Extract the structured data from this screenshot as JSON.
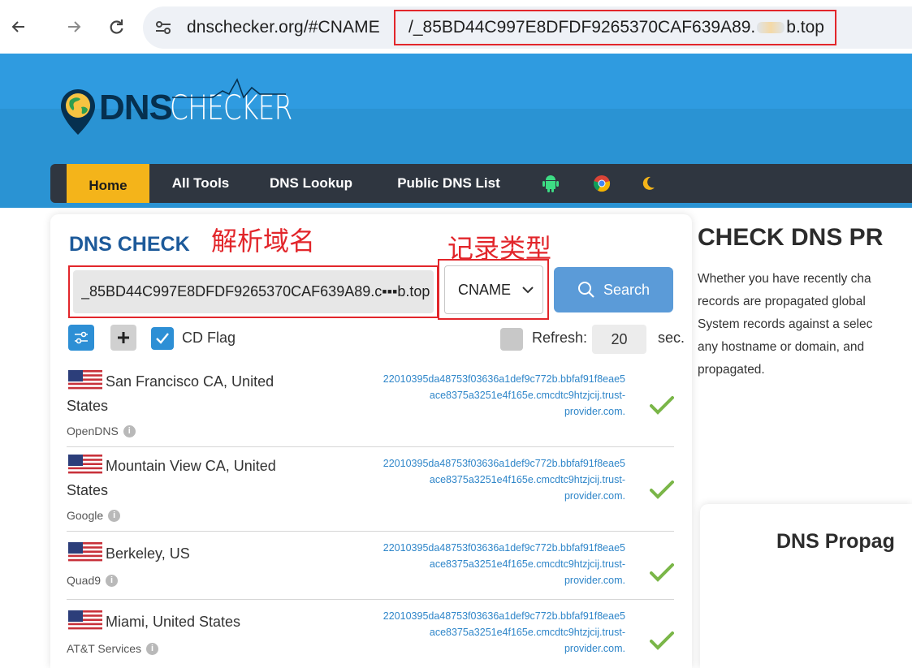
{
  "browser": {
    "url_prefix": "dnschecker.org/#CNAME",
    "url_highlight_start": "/_85BD44C997E8DFDF9265370CAF639A89.",
    "url_highlight_end": "b.top"
  },
  "logo": {
    "part1": "DNS",
    "part2": "CHECKER"
  },
  "nav": {
    "home": "Home",
    "all_tools": "All Tools",
    "dns_lookup": "DNS Lookup",
    "public_dns_list": "Public DNS List"
  },
  "dns_check": {
    "title": "DNS CHECK",
    "annotation_domain": "解析域名",
    "annotation_type": "记录类型",
    "domain_value": "_85BD44C997E8DFDF9265370CAF639A89.c▪▪▪b.top",
    "record_type": "CNAME",
    "search_label": "Search",
    "cd_flag_label": "CD Flag",
    "refresh_label": "Refresh:",
    "refresh_value": "20",
    "sec_label": "sec."
  },
  "results": [
    {
      "location": "San Francisco CA, United States",
      "provider": "OpenDNS",
      "cname": [
        "22010395da48753f03636a1def9c772b.bbfaf91f8eae5",
        "ace8375a3251e4f165e.cmcdtc9htzjcij.trust-",
        "provider.com."
      ]
    },
    {
      "location": "Mountain View CA, United States",
      "provider": "Google",
      "cname": [
        "22010395da48753f03636a1def9c772b.bbfaf91f8eae5",
        "ace8375a3251e4f165e.cmcdtc9htzjcij.trust-",
        "provider.com."
      ]
    },
    {
      "location": "Berkeley, US",
      "provider": "Quad9",
      "cname": [
        "22010395da48753f03636a1def9c772b.bbfaf91f8eae5",
        "ace8375a3251e4f165e.cmcdtc9htzjcij.trust-",
        "provider.com."
      ]
    },
    {
      "location": "Miami, United States",
      "provider": "AT&T Services",
      "cname": [
        "22010395da48753f03636a1def9c772b.bbfaf91f8eae5",
        "ace8375a3251e4f165e.cmcdtc9htzjcij.trust-",
        "provider.com."
      ]
    }
  ],
  "right": {
    "title": "CHECK DNS PR",
    "desc_lines": [
      "Whether you have recently cha",
      "records are propagated global",
      "System records against a selec",
      "any hostname or domain, and",
      "propagated."
    ],
    "prop_title": "DNS Propag"
  },
  "colors": {
    "header_blue": "#2a93d3",
    "nav_dark": "#2f3640",
    "home_yellow": "#f4b41a",
    "title_blue": "#1d5a9a",
    "annotation_red": "#e2262b",
    "success_green": "#7ab648"
  },
  "icons": {
    "back": "arrow-left-icon",
    "forward": "arrow-right-icon",
    "reload": "reload-icon",
    "site_info": "tune-icon",
    "android": "android-icon",
    "chrome": "chrome-icon",
    "dark_mode": "moon-icon",
    "search": "search-icon",
    "settings": "sliders-icon",
    "add": "plus-icon",
    "check": "checkmark-icon"
  }
}
